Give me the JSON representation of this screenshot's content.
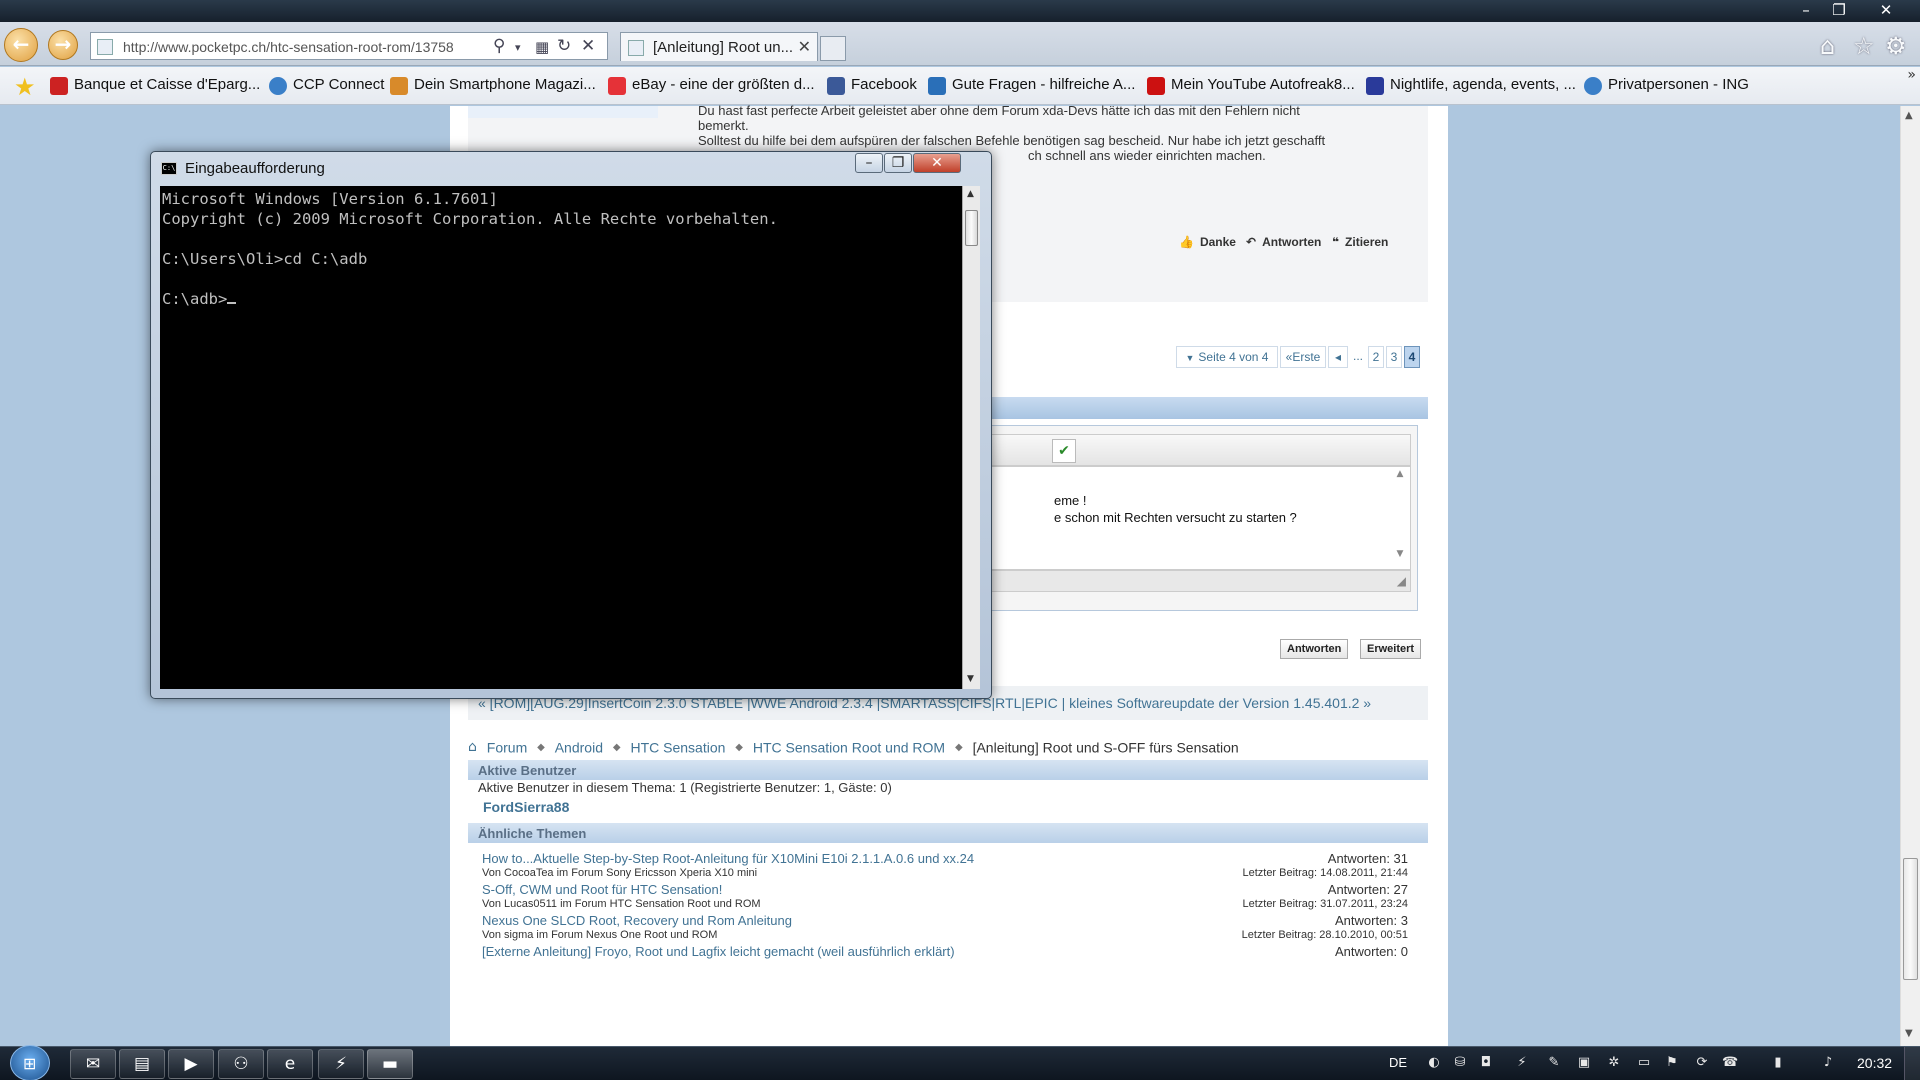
{
  "browser": {
    "url": "http://www.pocketpc.ch/htc-sensation-root-rom/13758",
    "tab_title": "[Anleitung] Root un...",
    "bookmarks": [
      {
        "label": "Banque et Caisse d'Eparg...",
        "icon": "bank-icon",
        "color": "#cc2222"
      },
      {
        "label": "CCP Connect",
        "icon": "ie-page-icon",
        "color": "#3a7fc8"
      },
      {
        "label": "Dein Smartphone Magazi...",
        "icon": "pocketpc-icon",
        "color": "#d88a2a"
      },
      {
        "label": "eBay - eine der größten d...",
        "icon": "ebay-icon",
        "color": "#e53238"
      },
      {
        "label": "Facebook",
        "icon": "facebook-icon",
        "color": "#3b5998"
      },
      {
        "label": "Gute Fragen - hilfreiche A...",
        "icon": "gutefrage-icon",
        "color": "#2a6fb8"
      },
      {
        "label": "Mein YouTube Autofreak8...",
        "icon": "youtube-icon",
        "color": "#cc1111"
      },
      {
        "label": "Nightlife, agenda, events, ...",
        "icon": "nightlife-icon",
        "color": "#2a3a9a"
      },
      {
        "label": "Privatpersonen - ING",
        "icon": "ie-page-icon",
        "color": "#3a7fc8"
      }
    ]
  },
  "post": {
    "lines": [
      "Du hast fast perfecte Arbeit geleistet aber ohne dem Forum xda-Devs hätte ich das mit den Fehlern nicht",
      "bemerkt.",
      "Solltest du hilfe bei dem aufspüren der falschen Befehle benötigen sag bescheid. Nur habe ich jetzt geschafft",
      "ch schnell ans wieder einrichten machen."
    ],
    "actions": {
      "thanks": "Danke",
      "reply": "Antworten",
      "quote": "Zitieren"
    }
  },
  "pagination": {
    "page_of": "Seite 4 von 4",
    "first": "Erste",
    "prev": "◂",
    "ellipsis": "...",
    "pages": [
      "2",
      "3",
      "4"
    ],
    "current": "4"
  },
  "quick_reply": {
    "lines": [
      "eme !",
      "e schon mit Rechten versucht zu starten ?"
    ],
    "reply_button": "Antworten",
    "advanced_button": "Erweitert"
  },
  "thread_nav": "« [ROM][AUG.29]InsertCoin 2.3.0 STABLE |WWE Android 2.3.4 |SMARTASS|CIFS|RTL|EPIC | kleines Softwareupdate der Version 1.45.401.2 »",
  "breadcrumb": {
    "items": [
      "Forum",
      "Android",
      "HTC Sensation",
      "HTC Sensation Root und ROM"
    ],
    "current": "[Anleitung] Root und S-OFF fürs Sensation"
  },
  "active_users": {
    "heading": "Aktive Benutzer",
    "summary": "Aktive Benutzer in diesem Thema: 1 (Registrierte Benutzer: 1, Gäste: 0)",
    "users": [
      "FordSierra88"
    ]
  },
  "similar_threads": {
    "heading": "Ähnliche Themen",
    "items": [
      {
        "title": "How to...Aktuelle Step-by-Step Root-Anleitung für X10Mini E10i 2.1.1.A.0.6 und xx.24",
        "sub": "Von CocoaTea im Forum Sony Ericsson Xperia X10 mini",
        "replies": "Antworten: 31",
        "last": "Letzter Beitrag: 14.08.2011, 21:44"
      },
      {
        "title": "S-Off, CWM und Root für HTC Sensation!",
        "sub": "Von Lucas0511 im Forum HTC Sensation Root und ROM",
        "replies": "Antworten: 27",
        "last": "Letzter Beitrag: 31.07.2011, 23:24"
      },
      {
        "title": "Nexus One SLCD Root, Recovery und Rom Anleitung",
        "sub": "Von sigma im Forum Nexus One Root und ROM",
        "replies": "Antworten: 3",
        "last": "Letzter Beitrag: 28.10.2010, 00:51"
      },
      {
        "title": "[Externe Anleitung] Froyo, Root und Lagfix leicht gemacht (weil ausführlich erklärt)",
        "sub": "",
        "replies": "Antworten: 0",
        "last": ""
      }
    ]
  },
  "cmd": {
    "title": "Eingabeaufforderung",
    "lines": [
      "Microsoft Windows [Version 6.1.7601]",
      "Copyright (c) 2009 Microsoft Corporation. Alle Rechte vorbehalten.",
      "",
      "C:\\Users\\Oli>cd C:\\adb",
      ""
    ],
    "prompt": "C:\\adb>"
  },
  "taskbar": {
    "language": "DE",
    "clock": "20:32",
    "pinned": [
      "outlook-icon",
      "explorer-folder-icon",
      "media-player-icon",
      "network-app-icon",
      "internet-explorer-icon",
      "winamp-icon",
      "cmd-icon"
    ],
    "tray_icons": [
      "nvidia-icon",
      "network-share-icon",
      "norton-icon",
      "winamp-tray-icon",
      "pdf-tray-icon",
      "tray-app-icon",
      "settings-tray-icon",
      "monitor-tray-icon",
      "flag-icon",
      "update-tray-icon",
      "phone-tray-icon",
      "battery-icon",
      "volume-icon"
    ]
  }
}
